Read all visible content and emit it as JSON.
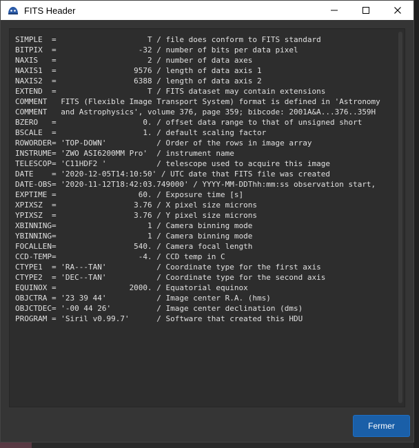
{
  "window": {
    "title": "FITS Header",
    "app_icon": "siril-icon"
  },
  "titlebar_buttons": [
    {
      "name": "minimize-icon",
      "glyph": "—"
    },
    {
      "name": "maximize-icon",
      "glyph": "☐"
    },
    {
      "name": "close-icon",
      "glyph": "✕"
    }
  ],
  "header_lines": [
    "SIMPLE  =                    T / file does conform to FITS standard",
    "BITPIX  =                  -32 / number of bits per data pixel",
    "NAXIS   =                    2 / number of data axes",
    "NAXIS1  =                 9576 / length of data axis 1",
    "NAXIS2  =                 6388 / length of data axis 2",
    "EXTEND  =                    T / FITS dataset may contain extensions",
    "COMMENT   FITS (Flexible Image Transport System) format is defined in 'Astronomy",
    "COMMENT   and Astrophysics', volume 376, page 359; bibcode: 2001A&A...376..359H",
    "BZERO   =                   0. / offset data range to that of unsigned short",
    "BSCALE  =                   1. / default scaling factor",
    "ROWORDER= 'TOP-DOWN'           / Order of the rows in image array",
    "INSTRUME= 'ZWO ASI6200MM Pro'  / instrument name",
    "TELESCOP= 'C11HDF2 '           / telescope used to acquire this image",
    "DATE    = '2020-12-05T14:10:50' / UTC date that FITS file was created",
    "DATE-OBS= '2020-11-12T18:42:03.749000' / YYYY-MM-DDThh:mm:ss observation start,",
    "EXPTIME =                  60. / Exposure time [s]",
    "XPIXSZ  =                 3.76 / X pixel size microns",
    "YPIXSZ  =                 3.76 / Y pixel size microns",
    "XBINNING=                    1 / Camera binning mode",
    "YBINNING=                    1 / Camera binning mode",
    "FOCALLEN=                 540. / Camera focal length",
    "CCD-TEMP=                  -4. / CCD temp in C",
    "CTYPE1  = 'RA---TAN'           / Coordinate type for the first axis",
    "CTYPE2  = 'DEC--TAN'           / Coordinate type for the second axis",
    "EQUINOX =                2000. / Equatorial equinox",
    "OBJCTRA = '23 39 44'           / Image center R.A. (hms)",
    "OBJCTDEC= '-00 44 26'          / Image center declination (dms)",
    "PROGRAM = 'Siril v0.99.7'      / Software that created this HDU"
  ],
  "buttons": {
    "close_label": "Fermer"
  },
  "colors": {
    "dialog_bg": "#353535",
    "text_area_bg": "#2d2d2d",
    "text": "#e0e0e0",
    "accent_button": "#1a5fa8"
  }
}
